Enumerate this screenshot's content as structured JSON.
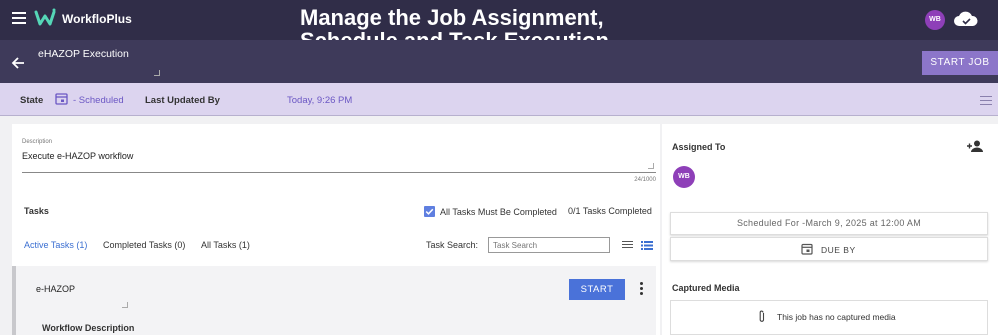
{
  "appbar": {
    "brand": "WorkfloPlus",
    "banner_line1": "Manage the Job Assignment,",
    "banner_line2": "Schedule and Task Execution",
    "user_initials": "WB"
  },
  "subheader": {
    "title": "eHAZOP Execution",
    "start_job_label": "START JOB"
  },
  "statebar": {
    "state_label": "State",
    "state_value": "- Scheduled",
    "updated_label": "Last Updated By",
    "updated_value": "Today, 9:26 PM"
  },
  "description": {
    "caption": "Description",
    "value": "Execute e-HAZOP workflow",
    "char_count": "24/1000"
  },
  "tasks": {
    "label": "Tasks",
    "all_must_complete_label": "All Tasks Must Be Completed",
    "all_must_complete_checked": true,
    "completed_count": "0/1 Tasks Completed",
    "tabs": [
      {
        "label": "Active Tasks (1)",
        "active": true
      },
      {
        "label": "Completed Tasks (0)",
        "active": false
      },
      {
        "label": "All Tasks (1)",
        "active": false
      }
    ],
    "search_label": "Task Search:",
    "search_placeholder": "Task Search"
  },
  "task_card": {
    "title": "e-HAZOP",
    "start_label": "START",
    "workflow_description_label": "Workflow Description"
  },
  "right": {
    "assigned_label": "Assigned To",
    "assignee_initials": "WB",
    "scheduled_for": "Scheduled For -March 9, 2025 at 12:00 AM",
    "due_by_label": "DUE BY",
    "captured_media_label": "Captured Media",
    "no_media_text": "This job has no captured media"
  },
  "colors": {
    "appbar": "#302d48",
    "subheader": "#3e3a5a",
    "statebar": "#dcd4ef",
    "accent_purple": "#8c76c9",
    "accent_blue": "#4a72d9",
    "avatar": "#8e3fb8"
  },
  "icons": [
    "menu-icon",
    "workfloplus-logo-icon",
    "cloud-sync-icon",
    "back-arrow-icon",
    "calendar-icon",
    "lines-menu-icon",
    "checkbox-icon",
    "list-view-icon",
    "detail-view-icon",
    "more-vert-icon",
    "add-person-icon",
    "paperclip-icon"
  ]
}
